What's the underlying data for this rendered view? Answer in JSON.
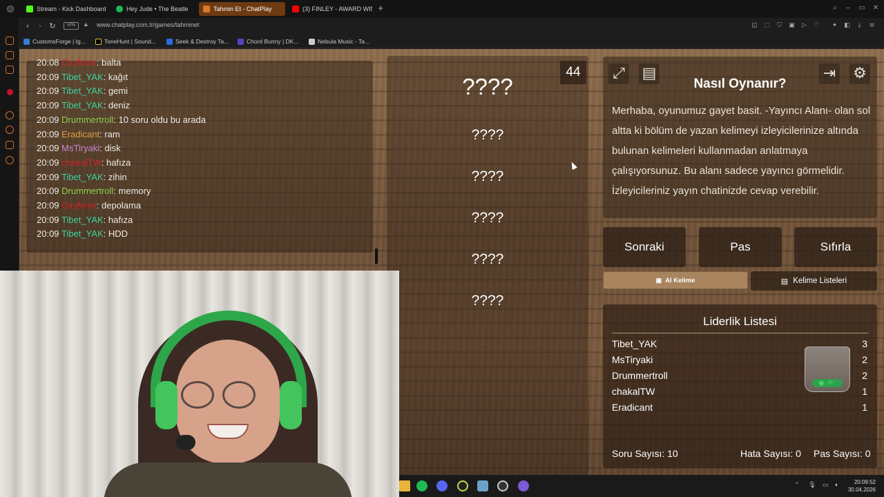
{
  "browser": {
    "tabs": [
      {
        "label": "Stream - Kick Dashboard",
        "color": "#53fc18"
      },
      {
        "label": "Hey Jude • The Beatle",
        "color": "#1db954"
      },
      {
        "label": "Tahmin Et - ChatPlay",
        "color": "#d67b2a"
      },
      {
        "label": "(3) FINLEY - AWARD WIN",
        "color": "#ff0000"
      }
    ],
    "url": "www.chatplay.com.tr/games/tahminet",
    "vpn_label": "VPN",
    "bookmarks": [
      {
        "label": "CustomsForge | Ig...",
        "color": "#3a7bd5"
      },
      {
        "label": "ToneHunt | Sound...",
        "color": "#000000"
      },
      {
        "label": "Seek & Destroy Ta...",
        "color": "#2d6cdf"
      },
      {
        "label": "Chord Bunny | DK...",
        "color": "#5b3fc4"
      },
      {
        "label": "Nebula Music - Ta...",
        "color": "#cccccc"
      }
    ]
  },
  "chat": {
    "lines": [
      {
        "time": "20:08",
        "user": "Oxyfenix",
        "user_color": "#d0232a",
        "msg": "balta"
      },
      {
        "time": "20:09",
        "user": "Tibet_YAK",
        "user_color": "#3fd4a0",
        "msg": "kağıt"
      },
      {
        "time": "20:09",
        "user": "Tibet_YAK",
        "user_color": "#3fd4a0",
        "msg": "gemi"
      },
      {
        "time": "20:09",
        "user": "Tibet_YAK",
        "user_color": "#3fd4a0",
        "msg": "deniz"
      },
      {
        "time": "20:09",
        "user": "Drummertroll",
        "user_color": "#8fd14f",
        "msg": "10 soru oldu bu arada"
      },
      {
        "time": "20:09",
        "user": "Eradicant",
        "user_color": "#e0a040",
        "msg": "ram"
      },
      {
        "time": "20:09",
        "user": "MsTiryaki",
        "user_color": "#c98ad8",
        "msg": "disk"
      },
      {
        "time": "20:09",
        "user": "chakalTW",
        "user_color": "#d0232a",
        "msg": "hafıza"
      },
      {
        "time": "20:09",
        "user": "Tibet_YAK",
        "user_color": "#3fd4a0",
        "msg": "zihin"
      },
      {
        "time": "20:09",
        "user": "Drummertroll",
        "user_color": "#8fd14f",
        "msg": "memory"
      },
      {
        "time": "20:09",
        "user": "Oxyfenix",
        "user_color": "#d0232a",
        "msg": "depolama"
      },
      {
        "time": "20:09",
        "user": "Tibet_YAK",
        "user_color": "#3fd4a0",
        "msg": "hafıza"
      },
      {
        "time": "20:09",
        "user": "Tibet_YAK",
        "user_color": "#3fd4a0",
        "msg": "HDD"
      }
    ]
  },
  "game": {
    "timer": "44",
    "main_word": "????",
    "forbidden_words": [
      "????",
      "????",
      "????",
      "????",
      "????"
    ]
  },
  "info": {
    "title": "Nasıl Oynanır?",
    "body": "Merhaba, oyunumuz gayet basit. -Yayıncı Alanı- olan sol altta ki bölüm de yazan kelimeyi izleyicilerinize altında bulunan kelimeleri kullanmadan anlatmaya çalışıyorsunuz. Bu alanı sadece yayıncı görmelidir. İzleyicileriniz yayın chatinizde cevap verebilir."
  },
  "actions": {
    "next": "Sonraki",
    "pass": "Pas",
    "reset": "Sıfırla",
    "ai_word": "AI Kelime",
    "word_lists": "Kelime Listeleri"
  },
  "leaderboard": {
    "title": "Liderlik Listesi",
    "entries": [
      {
        "name": "Tibet_YAK",
        "score": "3"
      },
      {
        "name": "MsTiryaki",
        "score": "2"
      },
      {
        "name": "Drummertroll",
        "score": "2"
      },
      {
        "name": "chakalTW",
        "score": "1"
      },
      {
        "name": "Eradicant",
        "score": "1"
      }
    ],
    "question_count": "Soru Sayısı: 10",
    "error_count": "Hata Sayısı: 0",
    "pass_count": "Pas Sayısı: 0"
  },
  "taskbar": {
    "time": "20:09:52",
    "date": "30.04.2026"
  }
}
